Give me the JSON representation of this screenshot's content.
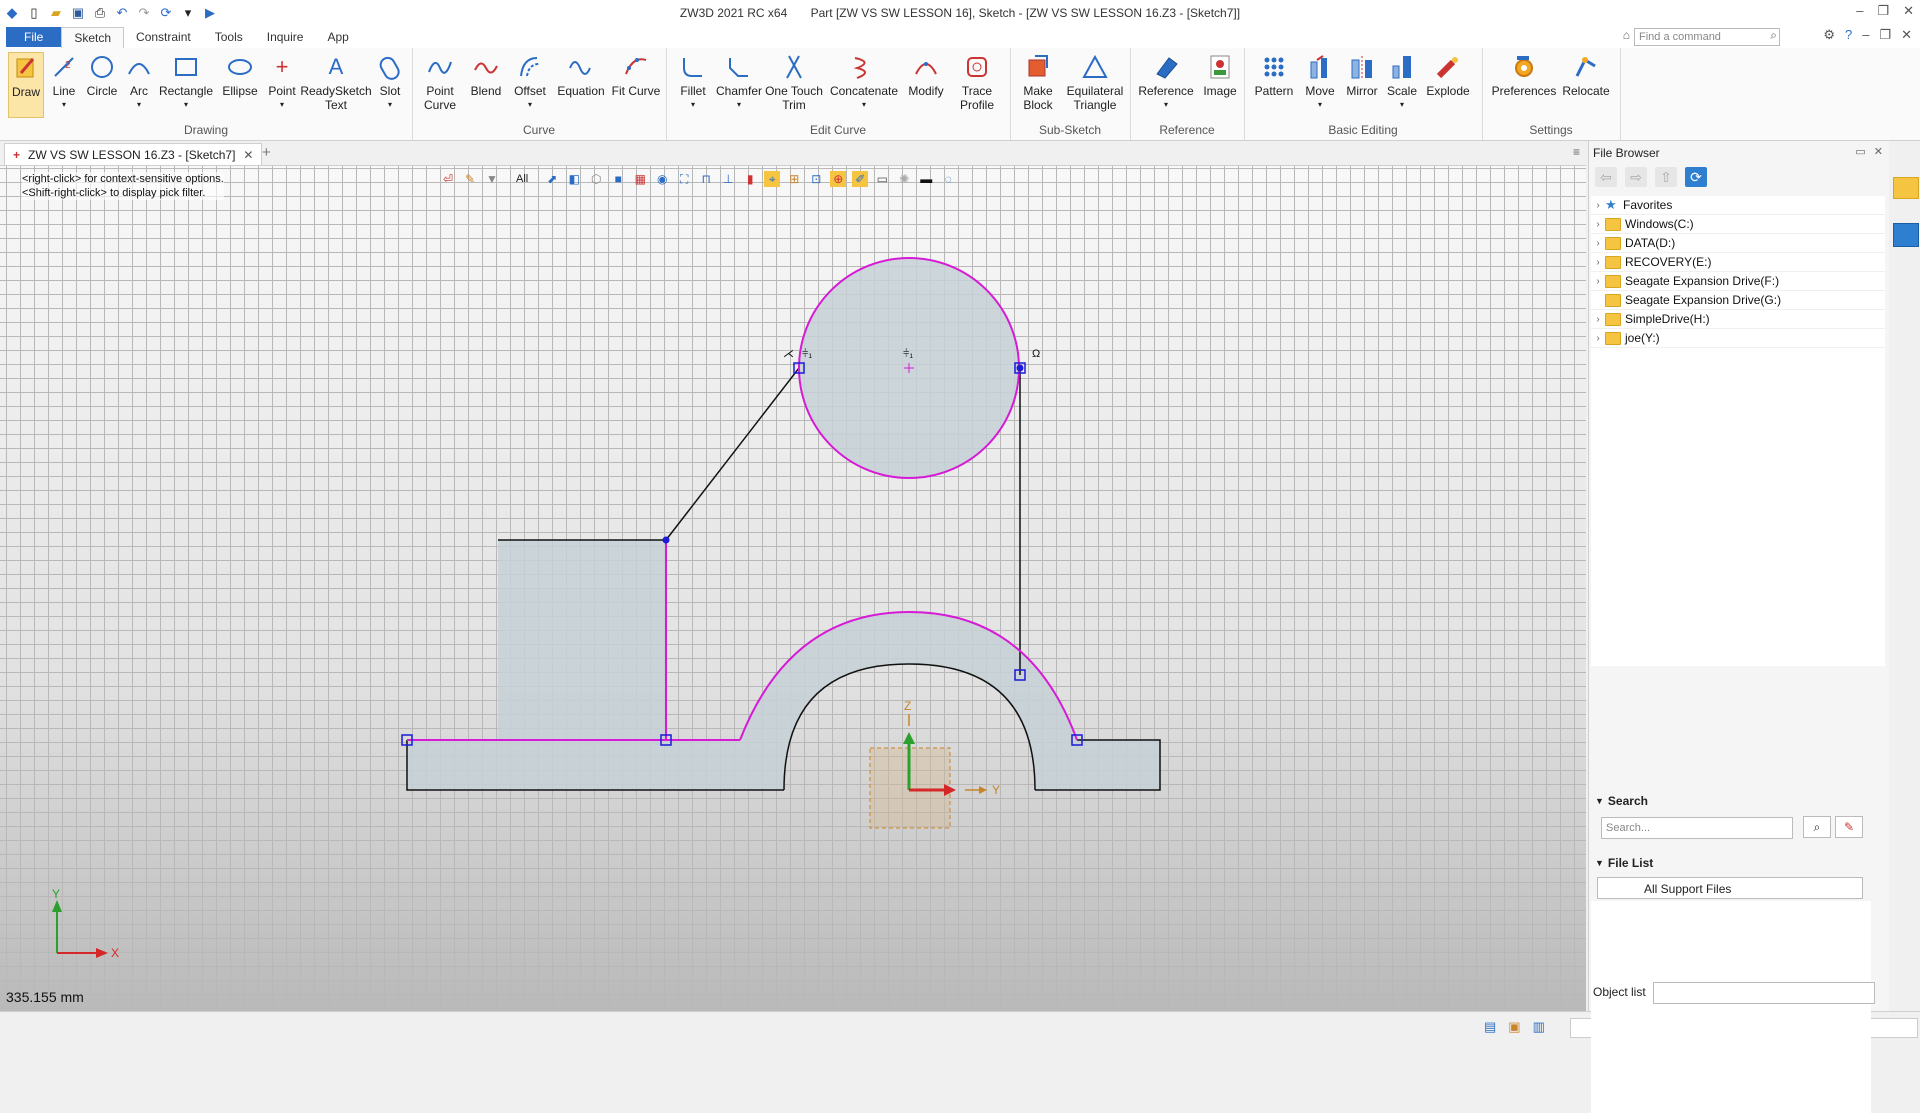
{
  "window": {
    "app_title": "ZW3D 2021 RC x64",
    "doc_title": "Part [ZW VS SW LESSON 16],  Sketch - [ZW VS SW LESSON 16.Z3 - [Sketch7]]"
  },
  "menu": {
    "file": "File",
    "tabs": [
      "Sketch",
      "Constraint",
      "Tools",
      "Inquire",
      "App"
    ]
  },
  "command_search": {
    "placeholder": "Find a command"
  },
  "ribbon": {
    "drawing_label": "Drawing",
    "curve_label": "Curve",
    "edit_curve_label": "Edit Curve",
    "subsketch_label": "Sub-Sketch",
    "reference_label": "Reference",
    "basic_editing_label": "Basic Editing",
    "settings_label": "Settings",
    "buttons": {
      "draw": "Draw",
      "line": "Line",
      "circle": "Circle",
      "arc": "Arc",
      "rectangle": "Rectangle",
      "ellipse": "Ellipse",
      "point": "Point",
      "readysketch_text_1": "ReadySketch",
      "readysketch_text_2": "Text",
      "slot": "Slot",
      "point_curve_1": "Point",
      "point_curve_2": "Curve",
      "blend": "Blend",
      "offset": "Offset",
      "equation": "Equation",
      "fit_curve": "Fit Curve",
      "fillet": "Fillet",
      "chamfer": "Chamfer",
      "one_touch_trim_1": "One Touch",
      "one_touch_trim_2": "Trim",
      "concatenate": "Concatenate",
      "modify": "Modify",
      "trace_profile_1": "Trace",
      "trace_profile_2": "Profile",
      "make_block_1": "Make",
      "make_block_2": "Block",
      "equilateral_triangle_1": "Equilateral",
      "equilateral_triangle_2": "Triangle",
      "reference": "Reference",
      "image": "Image",
      "pattern": "Pattern",
      "move": "Move",
      "mirror": "Mirror",
      "scale": "Scale",
      "explode": "Explode",
      "preferences": "Preferences",
      "relocate": "Relocate"
    }
  },
  "doc_tab": {
    "label": "ZW VS SW LESSON 16.Z3 - [Sketch7]"
  },
  "viewport": {
    "hint_1": "<right-click> for context-sensitive options.",
    "hint_2": "<Shift-right-click> to display pick filter.",
    "filter": "All",
    "measure": "335.155 mm",
    "axis_x": "X",
    "axis_y": "Y",
    "axis_z": "Z",
    "axis_y2": "Y",
    "colors": {
      "sketch_fill": "#c6d0d5",
      "selected_curve": "#d61bd6",
      "curve": "#111111",
      "handle": "#1b1bd9"
    }
  },
  "file_browser": {
    "title": "File Browser",
    "tree": [
      {
        "label": "Favorites",
        "kind": "star"
      },
      {
        "label": "Windows(C:)",
        "kind": "folder"
      },
      {
        "label": "DATA(D:)",
        "kind": "folder"
      },
      {
        "label": "RECOVERY(E:)",
        "kind": "folder"
      },
      {
        "label": "Seagate Expansion Drive(F:)",
        "kind": "folder"
      },
      {
        "label": "Seagate Expansion Drive(G:)",
        "kind": "folder"
      },
      {
        "label": "SimpleDrive(H:)",
        "kind": "folder"
      },
      {
        "label": "joe(Y:)",
        "kind": "folder"
      }
    ],
    "search_label": "Search",
    "search_placeholder": "Search...",
    "file_list_label": "File List",
    "file_list_value": "All Support Files",
    "object_list_label": "Object list"
  }
}
